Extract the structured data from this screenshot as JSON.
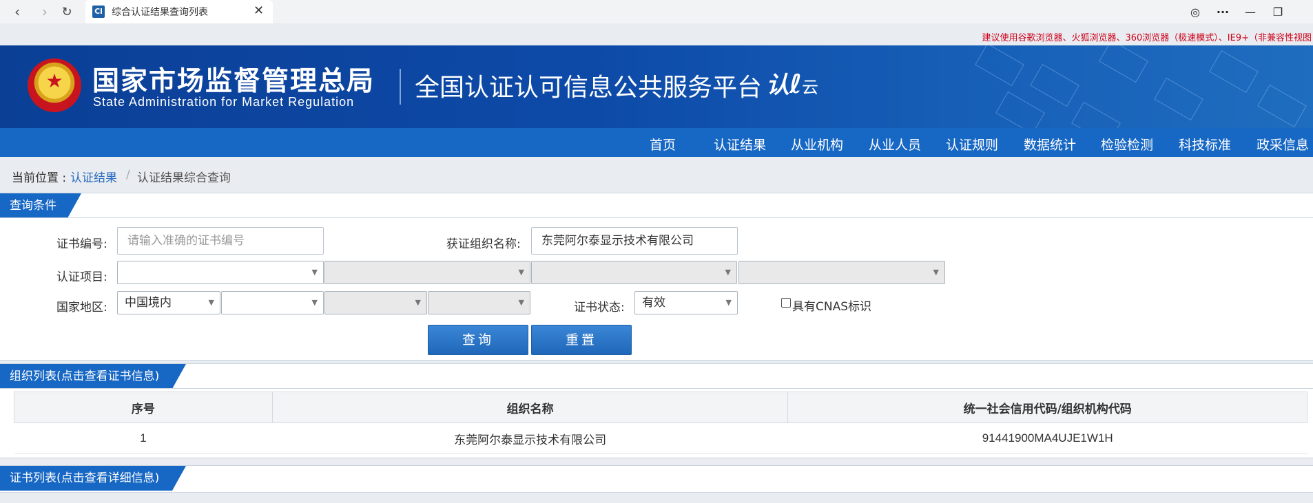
{
  "browser": {
    "tab_title": "综合认证结果查询列表",
    "favicon_text": "Cl",
    "nav_icons": [
      "back-icon",
      "forward-icon",
      "reload-icon"
    ],
    "window_icons": [
      "globe-icon",
      "more-icon",
      "minimize-icon",
      "restore-icon"
    ]
  },
  "notice": "建议使用谷歌浏览器、火狐浏览器、360浏览器（极速模式）、IE9+（非兼容性视图",
  "header": {
    "org_cn": "国家市场监督管理总局",
    "org_en": "State Administration  for  Market Regulation",
    "platform": "全国认证认可信息公共服务平台",
    "logo_text": "认",
    "logo_sub": "云"
  },
  "nav": [
    "首页",
    "认证结果",
    "从业机构",
    "从业人员",
    "认证规则",
    "数据统计",
    "检验检测",
    "科技标准",
    "政采信息"
  ],
  "breadcrumb": {
    "prefix": "当前位置 :",
    "link": "认证结果",
    "sep": "/",
    "current": "认证结果综合查询"
  },
  "query": {
    "tab": "查询条件",
    "cert_no_label": "证书编号:",
    "cert_no_placeholder": "请输入准确的证书编号",
    "org_name_label": "获证组织名称:",
    "org_name_value": "东莞阿尔泰显示技术有限公司",
    "project_label": "认证项目:",
    "region_label": "国家地区:",
    "region_value": "中国境内",
    "status_label": "证书状态:",
    "status_value": "有效",
    "cnas_label": "具有CNAS标识",
    "search_btn": "查询",
    "reset_btn": "重置"
  },
  "org_list": {
    "tab": "组织列表(点击查看证书信息)",
    "columns": [
      "序号",
      "组织名称",
      "统一社会信用代码/组织机构代码"
    ],
    "rows": [
      [
        "1",
        "东莞阿尔泰显示技术有限公司",
        "91441900MA4UJE1W1H"
      ]
    ]
  },
  "cert_list": {
    "tab": "证书列表(点击查看详细信息)"
  }
}
